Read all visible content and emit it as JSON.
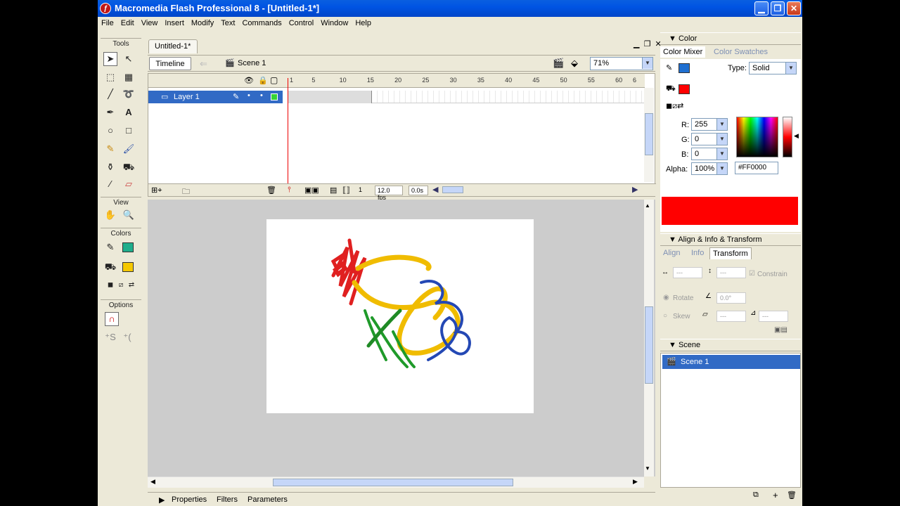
{
  "window": {
    "title": "Macromedia Flash Professional 8 - [Untitled-1*]"
  },
  "menu": [
    "File",
    "Edit",
    "View",
    "Insert",
    "Modify",
    "Text",
    "Commands",
    "Control",
    "Window",
    "Help"
  ],
  "tools": {
    "header": "Tools",
    "view_header": "View",
    "colors_header": "Colors",
    "options_header": "Options",
    "stroke_color": "#1fae8c",
    "fill_color": "#f5c800"
  },
  "document": {
    "tab": "Untitled-1*",
    "timeline_button": "Timeline",
    "scene_label": "Scene 1",
    "zoom": "71%"
  },
  "timeline": {
    "layer_name": "Layer 1",
    "ruler": [
      "1",
      "5",
      "10",
      "15",
      "20",
      "25",
      "30",
      "35",
      "40",
      "45",
      "50",
      "55",
      "60",
      "6"
    ],
    "current_frame": "1",
    "frame_rate": "12.0 fps",
    "elapsed": "0.0s"
  },
  "properties_tabs": [
    "Properties",
    "Filters",
    "Parameters"
  ],
  "color_panel": {
    "title": "Color",
    "tabs": [
      "Color Mixer",
      "Color Swatches"
    ],
    "type_label": "Type:",
    "type_value": "Solid",
    "r_label": "R:",
    "r": "255",
    "g_label": "G:",
    "g": "0",
    "b_label": "B:",
    "b": "0",
    "alpha_label": "Alpha:",
    "alpha": "100%",
    "hex": "#FF0000",
    "stroke_color": "#1f6fd0",
    "fill_color": "#ff0000"
  },
  "align_panel": {
    "title": "Align & Info & Transform",
    "tabs": [
      "Align",
      "Info",
      "Transform"
    ],
    "width": "---",
    "height": "---",
    "constrain": "Constrain",
    "rotate_label": "Rotate",
    "rotate_value": "0.0°",
    "skew_label": "Skew",
    "skew_h": "---",
    "skew_v": "---"
  },
  "scene_panel": {
    "title": "Scene",
    "scenes": [
      "Scene 1"
    ]
  }
}
